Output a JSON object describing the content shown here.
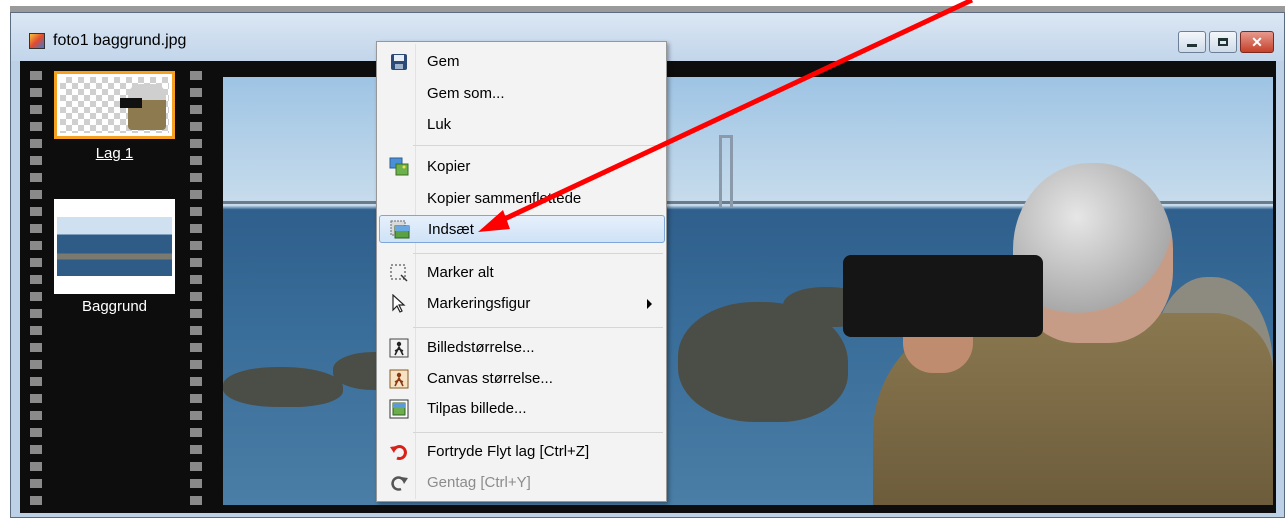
{
  "window": {
    "title": "foto1 baggrund.jpg"
  },
  "layers": [
    {
      "label": "Lag 1",
      "selected": true
    },
    {
      "label": "Baggrund",
      "selected": false
    }
  ],
  "context_menu": {
    "items": [
      {
        "label": "Gem",
        "icon": "floppy-disk-icon"
      },
      {
        "label": "Gem som...",
        "icon": ""
      },
      {
        "label": "Luk",
        "icon": ""
      },
      {
        "label": "Kopier",
        "icon": "copy-image-icon"
      },
      {
        "label": "Kopier sammenflettede",
        "icon": ""
      },
      {
        "label": "Indsæt",
        "icon": "paste-image-icon",
        "highlighted": true
      },
      {
        "label": "Marker alt",
        "icon": "select-all-icon"
      },
      {
        "label": "Markeringsfigur",
        "icon": "cursor-arrow-icon",
        "has_submenu": true
      },
      {
        "label": "Billedstørrelse...",
        "icon": "image-size-icon"
      },
      {
        "label": "Canvas størrelse...",
        "icon": "canvas-size-icon"
      },
      {
        "label": "Tilpas billede...",
        "icon": "fit-image-icon"
      },
      {
        "label": "Fortryde Flyt lag [Ctrl+Z]",
        "icon": "undo-icon"
      },
      {
        "label": "Gentag [Ctrl+Y]",
        "icon": "redo-icon",
        "disabled": true
      }
    ]
  },
  "colors": {
    "selection_border": "#f5a020",
    "annotation_arrow": "#ff0000",
    "menu_highlight": "#cfe2f7",
    "undo_icon": "#d9211a"
  }
}
